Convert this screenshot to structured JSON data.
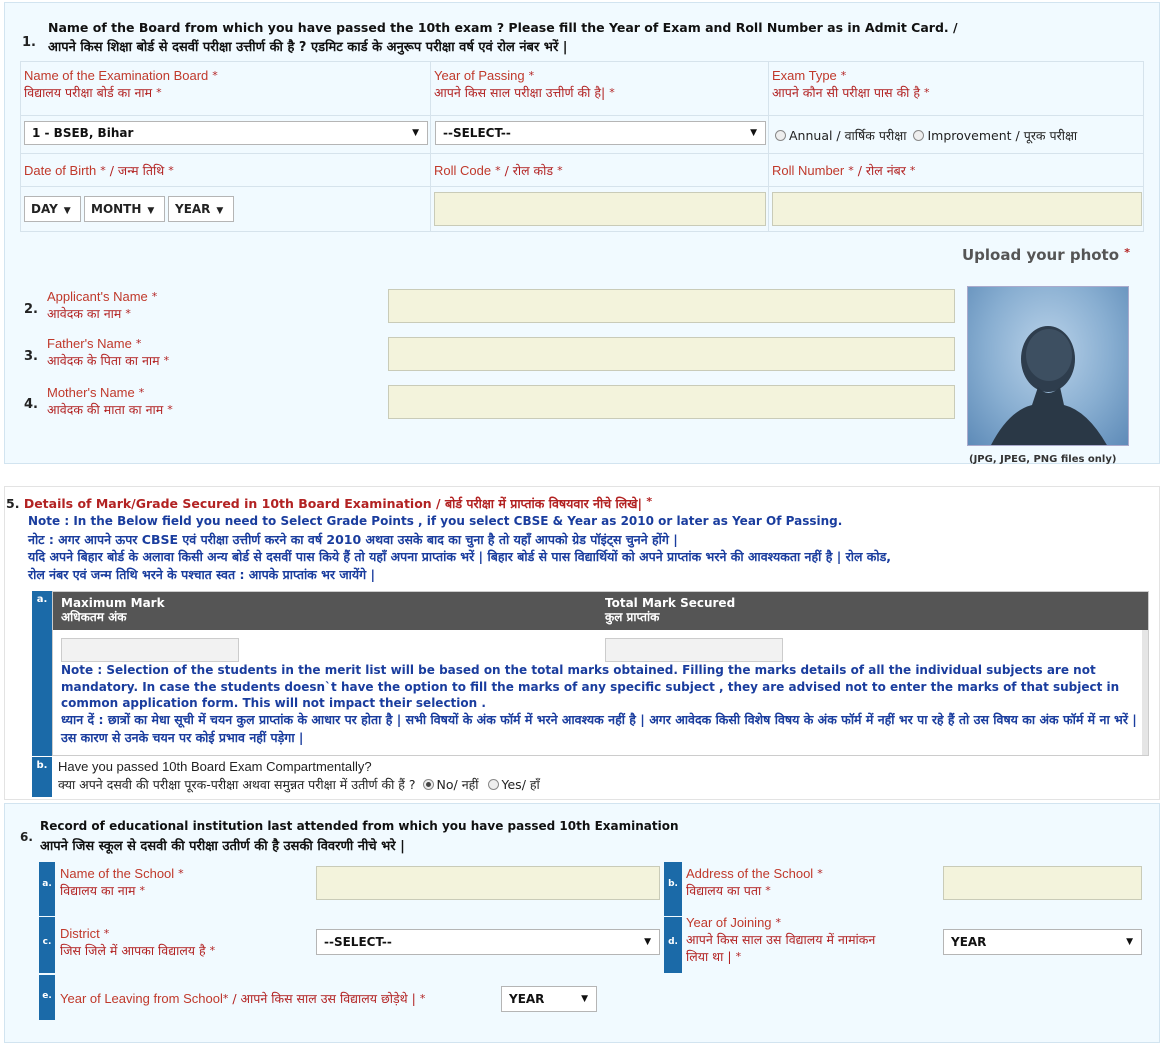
{
  "section1": {
    "number": "1.",
    "title_en": "Name of the Board from which you have passed the 10th exam ? Please fill the Year of Exam and Roll Number as in Admit Card. /",
    "title_hi": "आपने किस शिक्षा बोर्ड से दसवीं परीक्षा उत्तीर्ण की है ? एडमिट कार्ड के अनुरूप परीक्षा वर्ष एवं रोल नंबर भरें |",
    "board_label_en": "Name of the Examination Board",
    "board_label_hi": "विद्यालय परीक्षा बोर्ड का नाम",
    "board_value": "1 - BSEB, Bihar",
    "year_label_en": "Year of Passing",
    "year_label_hi": "आपने किस साल परीक्षा उत्तीर्ण की है|",
    "year_value": "--SELECT--",
    "exam_type_label_en": "Exam Type",
    "exam_type_label_hi": "आपने कौन सी परीक्षा पास की है",
    "exam_type_option_annual": "Annual / वार्षिक परीक्षा",
    "exam_type_option_improvement": "Improvement / पूरक परीक्षा",
    "dob_label": "Date of Birth",
    "dob_label_hi": "/ जन्म तिथि",
    "dob_day": "DAY",
    "dob_month": "MONTH",
    "dob_year": "YEAR",
    "roll_code_label": "Roll Code",
    "roll_code_label_hi": "/ रोल कोड",
    "roll_number_label": "Roll Number",
    "roll_number_label_hi": "/ रोल नंबर",
    "star": "*"
  },
  "photo": {
    "title": "Upload your photo",
    "note": "(JPG, JPEG, PNG files only)"
  },
  "section2": {
    "number": "2.",
    "label_en": "Applicant's Name",
    "label_hi": "आवेदक का नाम"
  },
  "section3": {
    "number": "3.",
    "label_en": "Father's Name",
    "label_hi": "आवेदक के पिता का नाम"
  },
  "section4": {
    "number": "4.",
    "label_en": "Mother's Name",
    "label_hi": "आवेदक की माता का नाम"
  },
  "section5": {
    "number": "5.",
    "title_en": "Details of Mark/Grade Secured in 10th Board Examination / ",
    "title_hi": "बोर्ड परीक्षा में प्राप्तांक विषयवार नीचे लिखे|",
    "note_en": "Note : In the Below field you need to Select Grade Points , if you select CBSE & Year as 2010 or later as Year Of Passing.",
    "note_hi1": "नोट : अगर आपने ऊपर CBSE एवं परीक्षा उत्तीर्ण करने का वर्ष 2010 अथवा उसके बाद का चुना है तो यहाँ आपको ग्रेड पॉइंट्स चुनने होंगे |",
    "note_hi2": "यदि अपने बिहार बोर्ड के अलावा किसी अन्य बोर्ड से दसवीं पास किये हैं तो यहाँ अपना प्राप्तांक भरें | बिहार बोर्ड से पास विद्यार्थियों को अपने प्राप्तांक भरने की आवश्यकता नहीं है | रोल कोड,",
    "note_hi3": "रोल नंबर एवं जन्म तिथि भरने के पश्चात स्वत : आपके प्राप्तांक भर जायेंगे |",
    "tag_a": "a.",
    "tag_b": "b.",
    "max_mark_en": "Maximum Mark",
    "max_mark_hi": "अधिकतम अंक",
    "total_mark_en": "Total Mark Secured",
    "total_mark_hi": "कुल प्राप्तांक",
    "merit_note_en": "Note : Selection of the students in the merit list will be based on the total marks obtained. Filling the marks details of all the individual subjects are not mandatory. In case the students doesn`t have the option to fill the marks of any specific subject , they are advised not to enter the marks of that subject in common application form. This will not impact their selection .",
    "merit_note_hi": "ध्यान दें : छात्रों का मेधा सूची में चयन कुल प्राप्तांक के आधार पर होता है | सभी विषयों के अंक फॉर्म में भरने आवश्यक नहीं है | अगर आवेदक किसी विशेष विषय के अंक फॉर्म में नहीं भर पा रहे हैं तो उस विषय का अंक फॉर्म में ना भरें | उस कारण से उनके चयन पर कोई प्रभाव नहीं पड़ेगा |",
    "compartment_q_en": "Have you passed 10th Board Exam Compartmentally?",
    "compartment_q_hi": "क्या अपने दसवी की परीक्षा पूरक-परीक्षा अथवा समुन्नत परीक्षा में उतीर्ण की हैं ?",
    "option_no": "No/ नहीं",
    "option_yes": "Yes/ हाँ"
  },
  "section6": {
    "number": "6.",
    "title_en": "Record of educational institution last attended from which you have passed 10th Examination",
    "title_hi": "आपने जिस स्कूल से दसवी की परीक्षा उतीर्ण की है उसकी विवरणी नीचे भरे |",
    "tag_a": "a.",
    "tag_b": "b.",
    "tag_c": "c.",
    "tag_d": "d.",
    "tag_e": "e.",
    "school_name_en": "Name of the School",
    "school_name_hi": "विद्यालय का नाम",
    "school_address_en": "Address of the School",
    "school_address_hi": "विद्यालय का पता",
    "district_en": "District",
    "district_hi": "जिस जिले में आपका विद्यालय है",
    "district_value": "--SELECT--",
    "year_joining_en": "Year of Joining",
    "year_joining_hi1": "आपने किस साल उस विद्यालय में नामांकन",
    "year_joining_hi2": "लिया था |",
    "year_joining_value": "YEAR",
    "year_leaving_en": "Year of Leaving from School",
    "year_leaving_hi": "/ आपने किस साल उस विद्यालय छोड़ेथे |",
    "year_leaving_value": "YEAR"
  }
}
